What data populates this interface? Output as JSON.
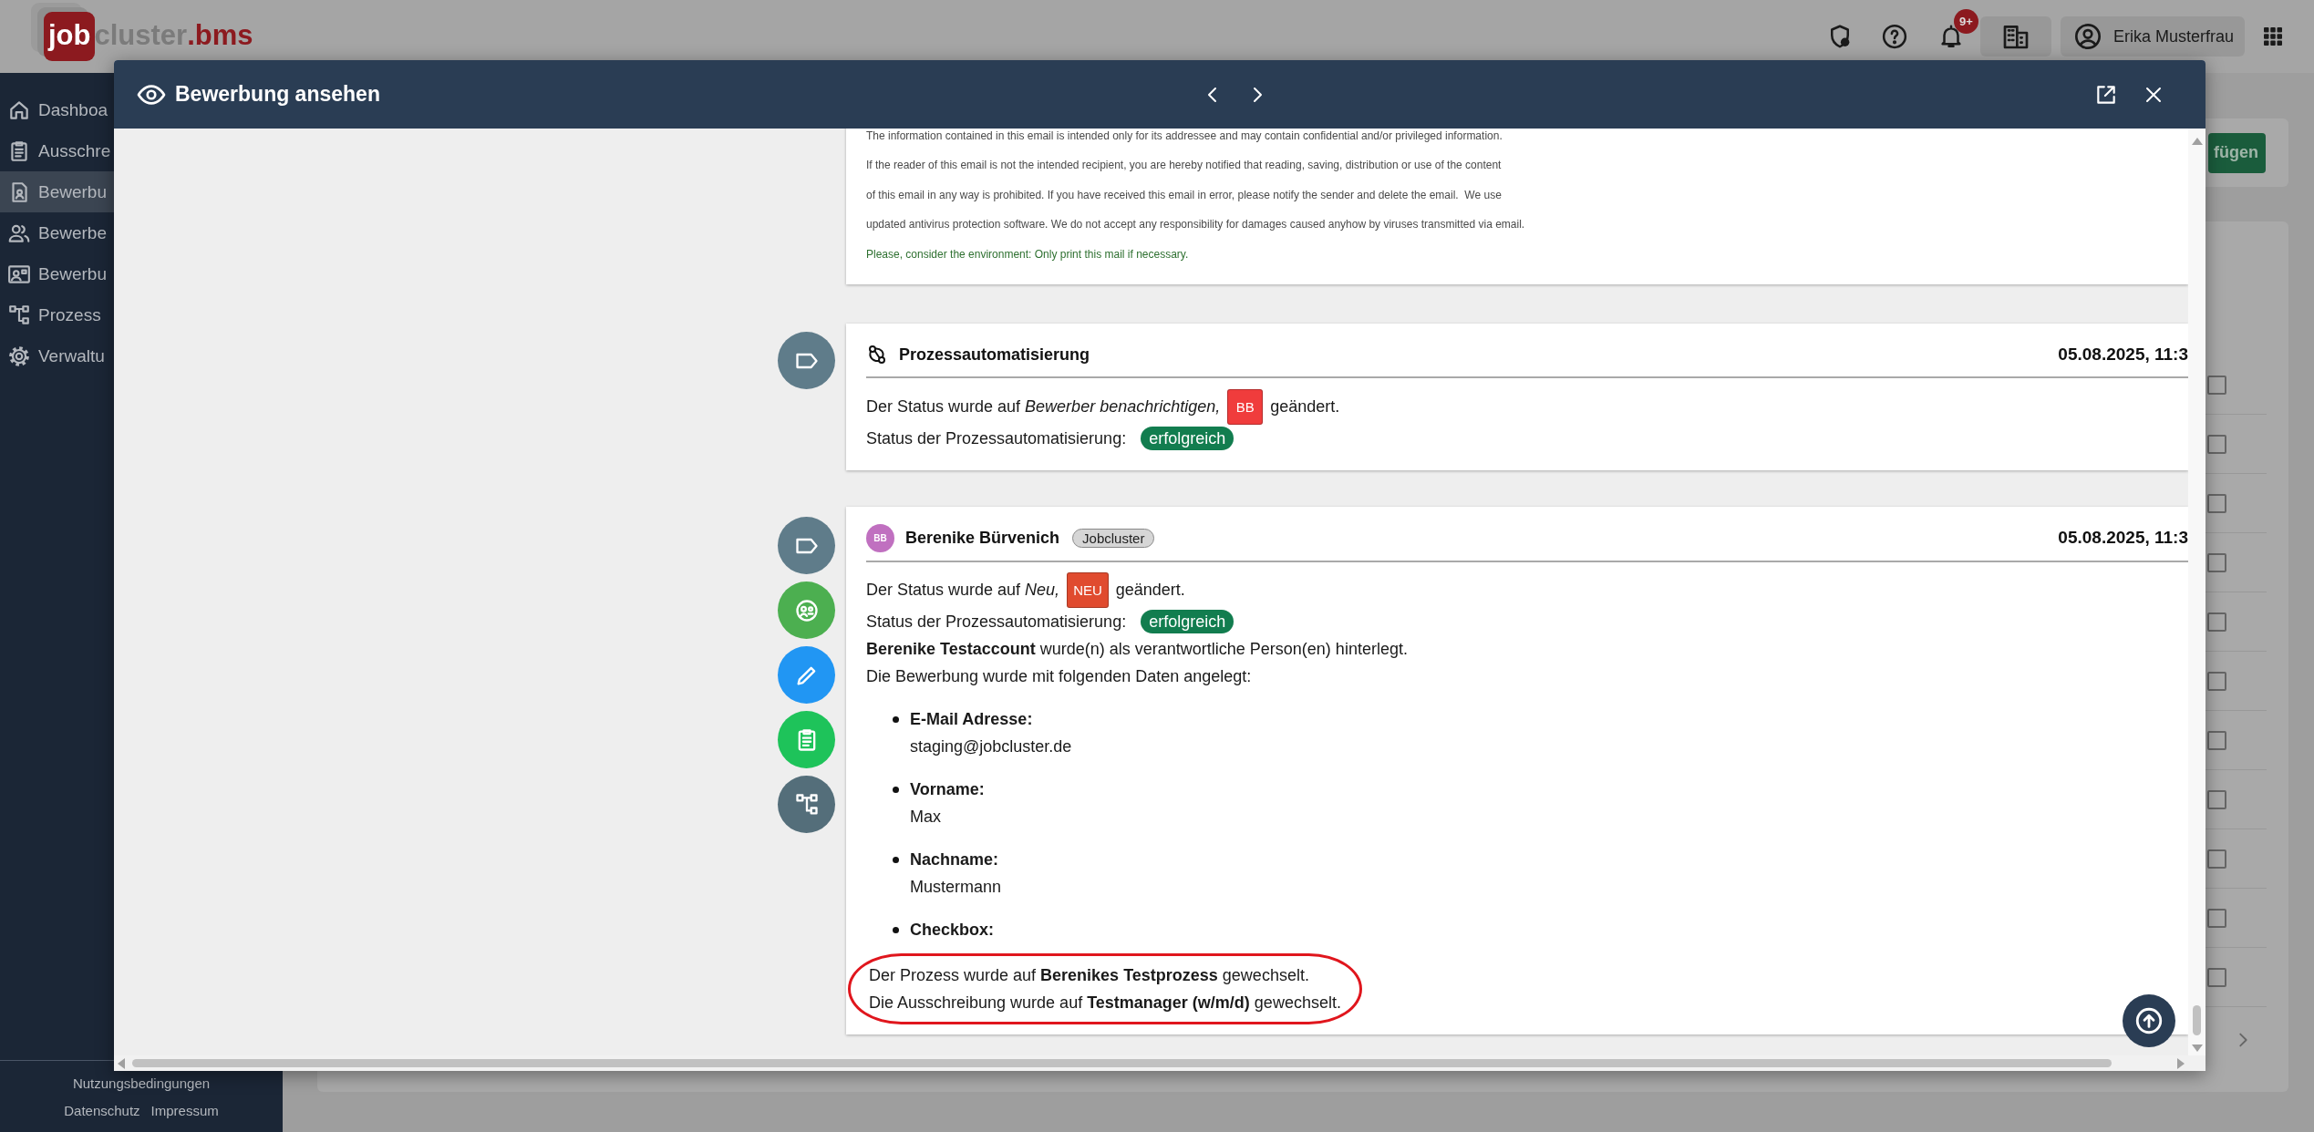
{
  "logo": [
    {
      "text": "job",
      "kind": "mark"
    },
    {
      "text": "cluster",
      "kind": "name"
    },
    {
      "text": ".bms",
      "kind": "suffix"
    }
  ],
  "topbar": {
    "notification_count": "9+",
    "user_name": "Erika Musterfrau"
  },
  "sidebar": {
    "items": [
      {
        "label": "Dashboa",
        "selected": false
      },
      {
        "label": "Ausschre",
        "selected": false
      },
      {
        "label": "Bewerbu",
        "selected": true
      },
      {
        "label": "Bewerbe",
        "selected": false
      },
      {
        "label": "Bewerbu",
        "selected": false
      },
      {
        "label": "Prozess",
        "selected": false
      },
      {
        "label": "Verwaltu",
        "selected": false
      }
    ],
    "footer_links": [
      "Nutzungsbedingungen",
      "Datenschutz",
      "Impressum"
    ]
  },
  "background": {
    "button": "fügen",
    "rows": [
      {
        "checked": false
      },
      {
        "checked": false
      },
      {
        "checked": false
      },
      {
        "checked": false
      },
      {
        "checked": false
      },
      {
        "checked": false
      },
      {
        "checked": false
      },
      {
        "checked": false
      },
      {
        "checked": false
      },
      {
        "checked": false
      },
      {
        "checked": false
      }
    ]
  },
  "modal": {
    "title": "Bewerbung ansehen",
    "entries": [
      {
        "kind": "email",
        "lines": [
          {
            "text": "The information contained in this email is intended only for its addressee and may contain confidential and/or privileged information.",
            "kind": "normal"
          },
          {
            "text": "If the reader of this email is not the intended recipient, you are hereby notified that reading, saving, distribution or use of the content",
            "kind": "normal"
          },
          {
            "text": "of this email in any way is prohibited. If you have received this email in error, please notify the sender and delete the email.  We use",
            "kind": "normal"
          },
          {
            "text": "updated antivirus protection software. We do not accept any responsibility for damages caused anyhow by viruses transmitted via email.",
            "kind": "normal"
          },
          {
            "text": "Please, consider the environment: Only print this mail if necessary.",
            "kind": "notice"
          }
        ]
      },
      {
        "kind": "automation",
        "markers": [
          {
            "kind": "label"
          }
        ],
        "title": "Prozessautomatisierung",
        "date": "05.08.2025, 11:3",
        "lines": [
          {
            "kind": "status",
            "text": "Der Status wurde auf *Bewerber benachrichtigen,*",
            "badge": "BB",
            "color": "#f03c3c",
            "after": "geändert."
          },
          {
            "kind": "result",
            "label": "Status der Prozessautomatisierung:",
            "value": "erfolgreich"
          }
        ]
      },
      {
        "kind": "user",
        "markers": [
          {
            "kind": "label"
          },
          {
            "kind": "contact"
          },
          {
            "kind": "edit"
          },
          {
            "kind": "form"
          },
          {
            "kind": "process"
          }
        ],
        "avatar": "BB",
        "author": "Berenike Bürvenich",
        "tag": "Jobcluster",
        "date": "05.08.2025, 11:3",
        "lines": [
          {
            "kind": "status",
            "text": "Der Status wurde auf *Neu,*",
            "badge": "NEU",
            "color": "#e04b2f",
            "after": "geändert."
          },
          {
            "kind": "result",
            "label": "Status der Prozessautomatisierung:",
            "value": "erfolgreich"
          },
          {
            "kind": "text",
            "text": "**Berenike Testaccount** wurde(n) als verantwortliche Person(en) hinterlegt."
          },
          {
            "kind": "text",
            "text": "Die Bewerbung wurde mit folgenden Daten angelegt:"
          },
          {
            "kind": "fields",
            "items": [
              {
                "label": "E-Mail Adresse:",
                "value": "staging@jobcluster.de"
              },
              {
                "label": "Vorname:",
                "value": "Max"
              },
              {
                "label": "Nachname:",
                "value": "Mustermann"
              },
              {
                "label": "Checkbox:"
              }
            ]
          },
          {
            "kind": "highlight",
            "lines": [
              "Der Prozess wurde auf **Berenikes Testprozess** gewechselt.",
              "Die Ausschreibung wurde auf **Testmanager (w/m/d)** gewechselt."
            ]
          }
        ]
      }
    ]
  }
}
